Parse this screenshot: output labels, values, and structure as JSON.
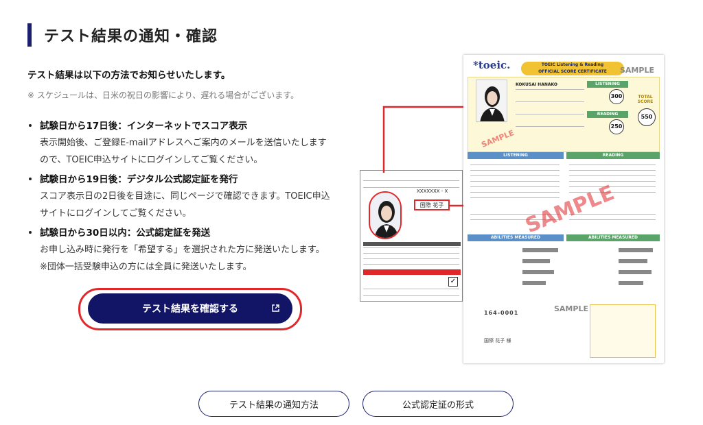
{
  "section": {
    "title": "テスト結果の通知・確認",
    "lead": "テスト結果は以下の方法でお知らせいたします。",
    "note": "※ スケジュールは、日米の祝日の影響により、遅れる場合がございます。"
  },
  "steps": [
    {
      "title": "試験日から17日後：インターネットでスコア表示",
      "lines": [
        "表示開始後、ご登録E-mailアドレスへご案内のメールを送信いたします",
        "ので、TOEIC申込サイトにログインしてご覧ください。"
      ]
    },
    {
      "title": "試験日から19日後：デジタル公式認定証を発行",
      "lines": [
        "スコア表示日の2日後を目途に、同じページで確認できます。TOEIC申込",
        "サイトにログインしてご覧ください。"
      ]
    },
    {
      "title": "試験日から30日以内：公式認定証を発送",
      "lines": [
        "お申し込み時に発行を「希望する」を選択された方に発送いたします。",
        "※団体一括受験申込の方には全員に発送いたします。"
      ]
    }
  ],
  "cta": {
    "label": "テスト結果を確認する"
  },
  "sample_image": {
    "form_name": "国際 花子",
    "form_id": "XXXXXXX - X",
    "cert_logo": "*toeic.",
    "cert_banner_1": "TOEIC Listening & Reading",
    "cert_banner_2": "OFFICIAL SCORE CERTIFICATE",
    "cert_sample": "SAMPLE",
    "cert_name": "KOKUSAI HANAKO",
    "listening_head": "LISTENING",
    "reading_head": "READING",
    "total_head": "TOTAL SCORE",
    "score_listening": "300",
    "score_reading": "250",
    "score_total": "550",
    "abilities_head": "ABILITIES MEASURED",
    "postal": "164-0001",
    "address_name": "国際 花子 様"
  },
  "links": [
    {
      "label": "テスト結果の通知方法"
    },
    {
      "label": "公式認定証の形式"
    }
  ],
  "colors": {
    "accent_navy": "#121566",
    "highlight_red": "#e0282b",
    "listening_blue": "#5a8fc8",
    "reading_green": "#5aa46a"
  }
}
